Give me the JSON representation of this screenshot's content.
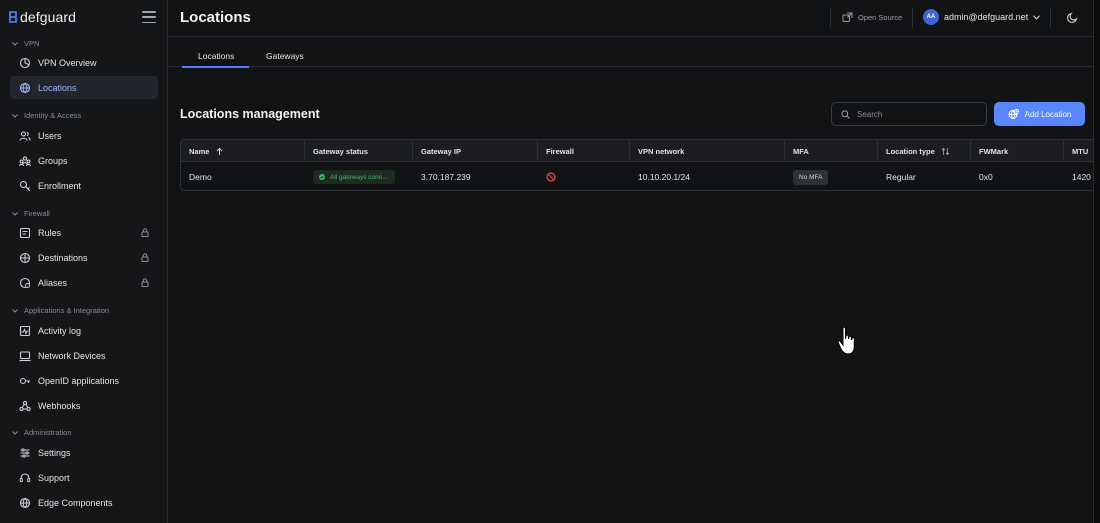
{
  "brand": {
    "name": "defguard",
    "accent": "#5a86ff"
  },
  "sidebar": {
    "sections": [
      {
        "title": "VPN",
        "items": [
          {
            "label": "VPN Overview",
            "icon": "dashboard-icon"
          },
          {
            "label": "Locations",
            "icon": "globe-icon",
            "active": true
          }
        ]
      },
      {
        "title": "Identity & Access",
        "items": [
          {
            "label": "Users",
            "icon": "users-icon"
          },
          {
            "label": "Groups",
            "icon": "groups-icon"
          },
          {
            "label": "Enrollment",
            "icon": "enrollment-icon"
          }
        ]
      },
      {
        "title": "Firewall",
        "items": [
          {
            "label": "Rules",
            "icon": "rules-icon",
            "locked": true
          },
          {
            "label": "Destinations",
            "icon": "destinations-icon",
            "locked": true
          },
          {
            "label": "Aliases",
            "icon": "aliases-icon",
            "locked": true
          }
        ]
      },
      {
        "title": "Applications & Integration",
        "items": [
          {
            "label": "Activity log",
            "icon": "activity-log-icon"
          },
          {
            "label": "Network Devices",
            "icon": "network-devices-icon"
          },
          {
            "label": "OpenID applications",
            "icon": "openid-icon"
          },
          {
            "label": "Webhooks",
            "icon": "webhooks-icon"
          }
        ]
      },
      {
        "title": "Administration",
        "items": [
          {
            "label": "Settings",
            "icon": "settings-icon"
          },
          {
            "label": "Support",
            "icon": "support-icon"
          },
          {
            "label": "Edge Components",
            "icon": "edge-components-icon"
          }
        ]
      }
    ]
  },
  "header": {
    "title": "Locations",
    "open_source_label": "Open Source",
    "user": {
      "initials": "AA",
      "email": "admin@defguard.net"
    }
  },
  "tabs": [
    {
      "label": "Locations",
      "active": true
    },
    {
      "label": "Gateways"
    }
  ],
  "main": {
    "section_title": "Locations management",
    "search_placeholder": "Search",
    "add_button_label": "Add Location"
  },
  "table": {
    "columns": [
      "Name",
      "Gateway status",
      "Gateway IP",
      "Firewall",
      "VPN network",
      "MFA",
      "Location type",
      "FWMark",
      "MTU"
    ],
    "rows": [
      {
        "name": "Demo",
        "gateway_status": "All gateways conn...",
        "gateway_ip": "3.70.187.239",
        "firewall": "disabled",
        "vpn_network": "10.10.20.1/24",
        "mfa": "No MFA",
        "location_type": "Regular",
        "fwmark": "0x0",
        "mtu": "1420"
      }
    ]
  },
  "colors": {
    "status_ok": "#3fba6b",
    "firewall_off": "#e5484d",
    "active_nav": "#9fb7ff"
  }
}
